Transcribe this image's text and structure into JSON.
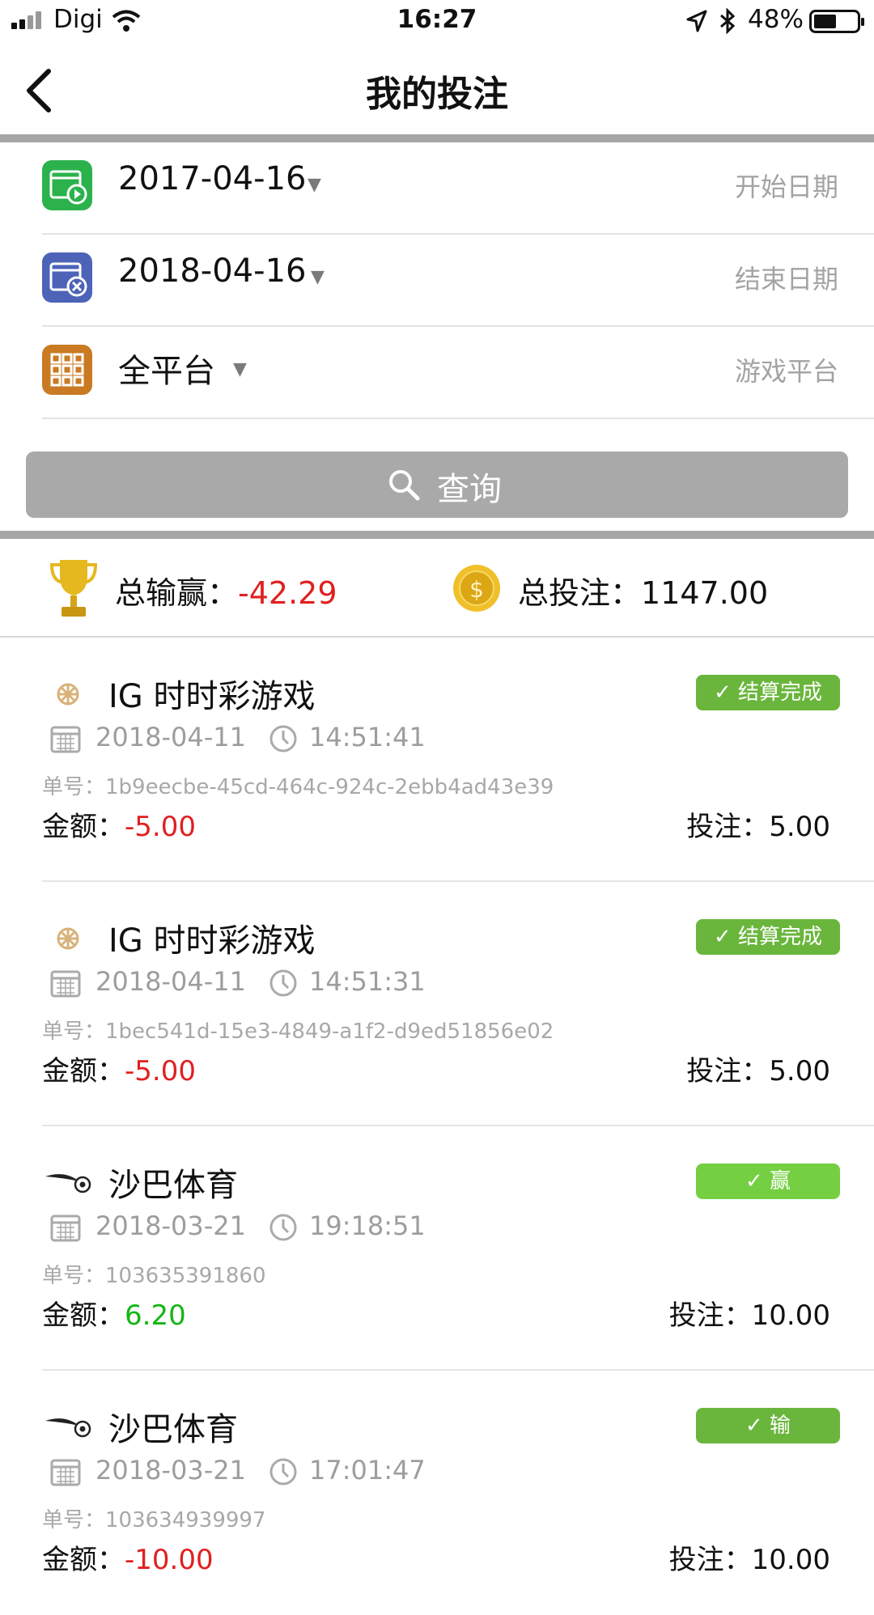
{
  "status_bar": {
    "carrier": "Digi",
    "time": "16:27",
    "battery": "48%"
  },
  "nav": {
    "title": "我的投注"
  },
  "filters": [
    {
      "value": "2017-04-16",
      "hint": "开始日期",
      "icon": "calendar-play-icon",
      "color": "#2bb24c"
    },
    {
      "value": "2018-04-16",
      "hint": "结束日期",
      "icon": "calendar-close-icon",
      "color": "#4c63b8"
    },
    {
      "value": "全平台",
      "hint": "游戏平台",
      "icon": "grid-icon",
      "color": "#c97a22"
    }
  ],
  "query_button": {
    "label": "查询"
  },
  "summary": {
    "winloss_label": "总输赢：",
    "winloss_value": "-42.29",
    "total_bet_label": "总投注：",
    "total_bet_value": "1147.00"
  },
  "records": [
    {
      "game": "IG 时时彩游戏",
      "status": "结算完成",
      "date": "2018-04-11",
      "time": "14:51:41",
      "order_label": "单号：",
      "order_no": "1b9eecbe-45cd-464c-924c-2ebb4ad43e39",
      "amount_label": "金额：",
      "amount": "-5.00",
      "bet_label": "投注：",
      "bet": "5.00",
      "logo": "ig-logo-icon"
    },
    {
      "game": "IG 时时彩游戏",
      "status": "结算完成",
      "date": "2018-04-11",
      "time": "14:51:31",
      "order_label": "单号：",
      "order_no": "1bec541d-15e3-4849-a1f2-d9ed51856e02",
      "amount_label": "金额：",
      "amount": "-5.00",
      "bet_label": "投注：",
      "bet": "5.00",
      "logo": "ig-logo-icon"
    },
    {
      "game": "沙巴体育",
      "status": "赢",
      "date": "2018-03-21",
      "time": "19:18:51",
      "order_label": "单号：",
      "order_no": "103635391860",
      "amount_label": "金额：",
      "amount": "6.20",
      "bet_label": "投注：",
      "bet": "10.00",
      "logo": "saba-logo-icon"
    },
    {
      "game": "沙巴体育",
      "status": "输",
      "date": "2018-03-21",
      "time": "17:01:47",
      "order_label": "单号：",
      "order_no": "103634939997",
      "amount_label": "金额：",
      "amount": "-10.00",
      "bet_label": "投注：",
      "bet": "10.00",
      "logo": "saba-logo-icon"
    }
  ]
}
